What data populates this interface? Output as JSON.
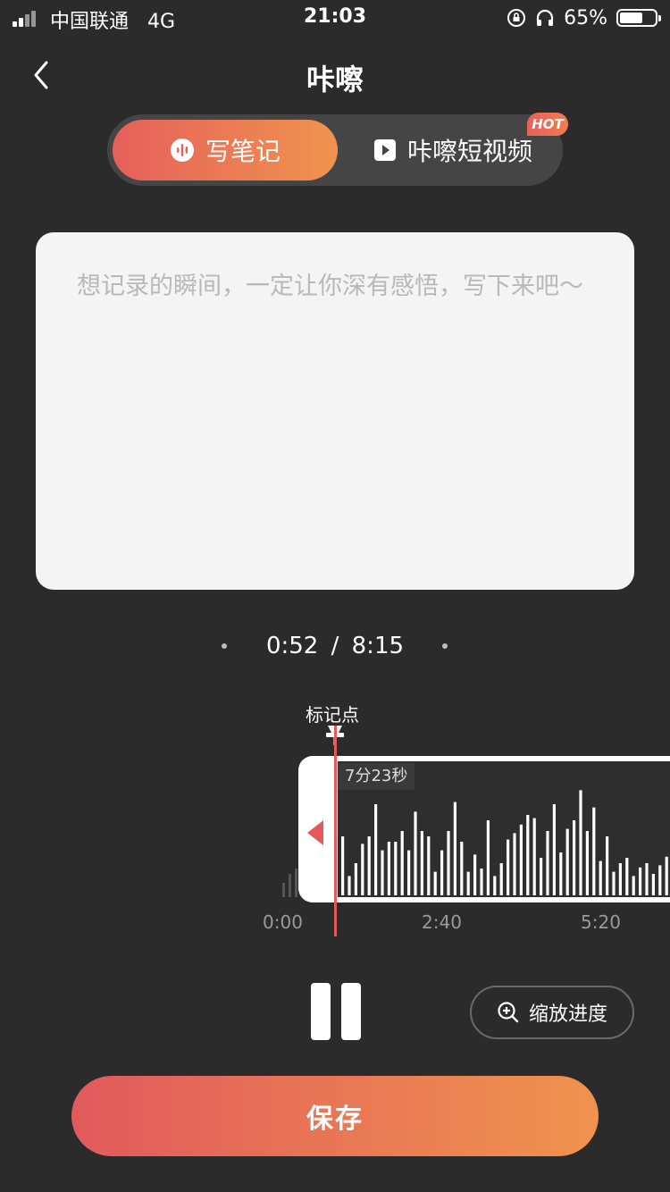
{
  "status_bar": {
    "carrier": "中国联通",
    "network": "4G",
    "time": "21:03",
    "battery_percent": "65%",
    "battery_level": 0.65
  },
  "nav": {
    "title": "咔嚓",
    "back_icon": "chevron-left-icon"
  },
  "tabs": [
    {
      "label": "写笔记",
      "icon": "audio-wave-icon",
      "active": true
    },
    {
      "label": "咔嚓短视频",
      "icon": "play-square-icon",
      "active": false
    }
  ],
  "hot_badge": "HOT",
  "note": {
    "placeholder": "想记录的瞬间，一定让你深有感悟，写下来吧～",
    "value": ""
  },
  "player": {
    "current": "0:52",
    "separator": "/",
    "total": "8:15",
    "marker_label": "标记点",
    "tooltip": "7分23秒",
    "timeline_ticks": [
      "0:00",
      "2:40",
      "5:20"
    ],
    "waveform_levels": [
      0.55,
      0.18,
      0.3,
      0.48,
      0.55,
      0.85,
      0.42,
      0.5,
      0.5,
      0.6,
      0.42,
      0.78,
      0.6,
      0.55,
      0.22,
      0.42,
      0.6,
      0.87,
      0.5,
      0.22,
      0.38,
      0.25,
      0.7,
      0.18,
      0.3,
      0.52,
      0.58,
      0.66,
      0.75,
      0.72,
      0.35,
      0.6,
      0.85,
      0.4,
      0.62,
      0.7,
      0.98,
      0.6,
      0.82,
      0.32,
      0.55,
      0.22,
      0.3,
      0.35,
      0.18,
      0.26,
      0.3,
      0.2,
      0.28,
      0.36,
      0.2,
      0.42
    ]
  },
  "controls": {
    "zoom_label": "缩放进度",
    "zoom_icon": "zoom-in-icon",
    "pause_icon": "pause-icon"
  },
  "save_label": "保存",
  "colors": {
    "accent_start": "#e6605c",
    "accent_end": "#f0934e",
    "playhead": "#e5595b",
    "background": "#2b2b2b"
  }
}
